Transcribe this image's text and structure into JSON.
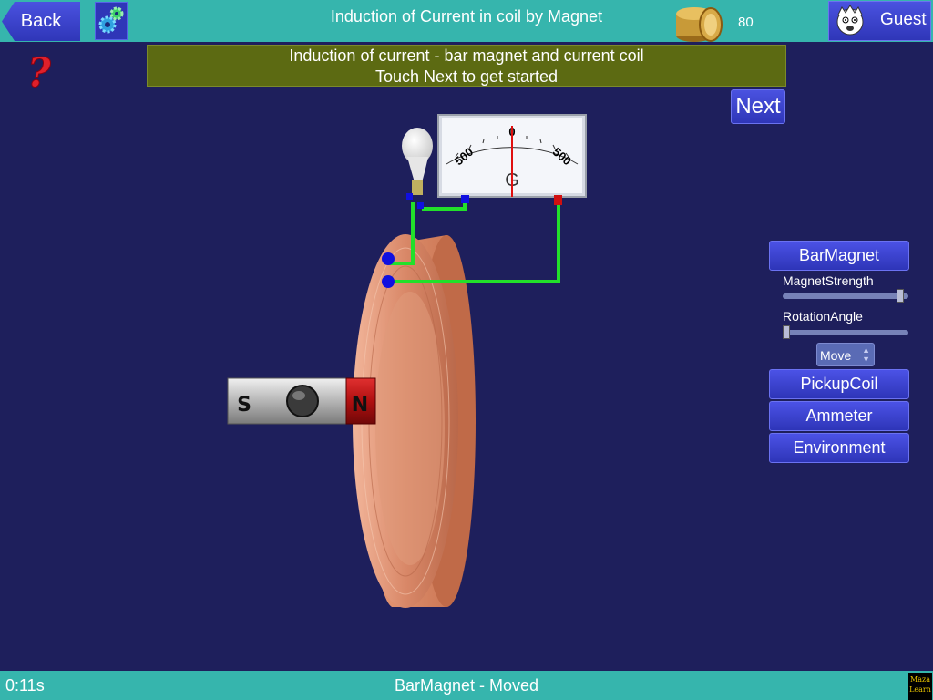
{
  "header": {
    "back_label": "Back",
    "title": "Induction of Current in coil by Magnet",
    "coin_count": "80",
    "user_label": "Guest"
  },
  "banner": {
    "line1": "Induction of current - bar magnet and current coil",
    "line2": "Touch Next to get started"
  },
  "next_label": "Next",
  "galvanometer": {
    "scale_left": "500",
    "scale_center": "0",
    "scale_right": "500",
    "symbol": "G"
  },
  "magnet": {
    "south_label": "S",
    "north_label": "N"
  },
  "panel": {
    "bar_magnet_label": "BarMagnet",
    "magnet_strength_label": "MagnetStrength",
    "magnet_strength_value": 0.96,
    "rotation_angle_label": "RotationAngle",
    "rotation_angle_value": 0.0,
    "mode_value": "Move",
    "pickup_coil_label": "PickupCoil",
    "ammeter_label": "Ammeter",
    "environment_label": "Environment"
  },
  "status": {
    "timer": "0:11s",
    "message": "BarMagnet - Moved"
  },
  "logo_text": "Maza Learn",
  "colors": {
    "background": "#1e1f5c",
    "bar": "#36b5ad",
    "button": "#3a41cc",
    "banner": "#5c6a12",
    "wire": "#22e02a",
    "copper": "#d8896a"
  }
}
